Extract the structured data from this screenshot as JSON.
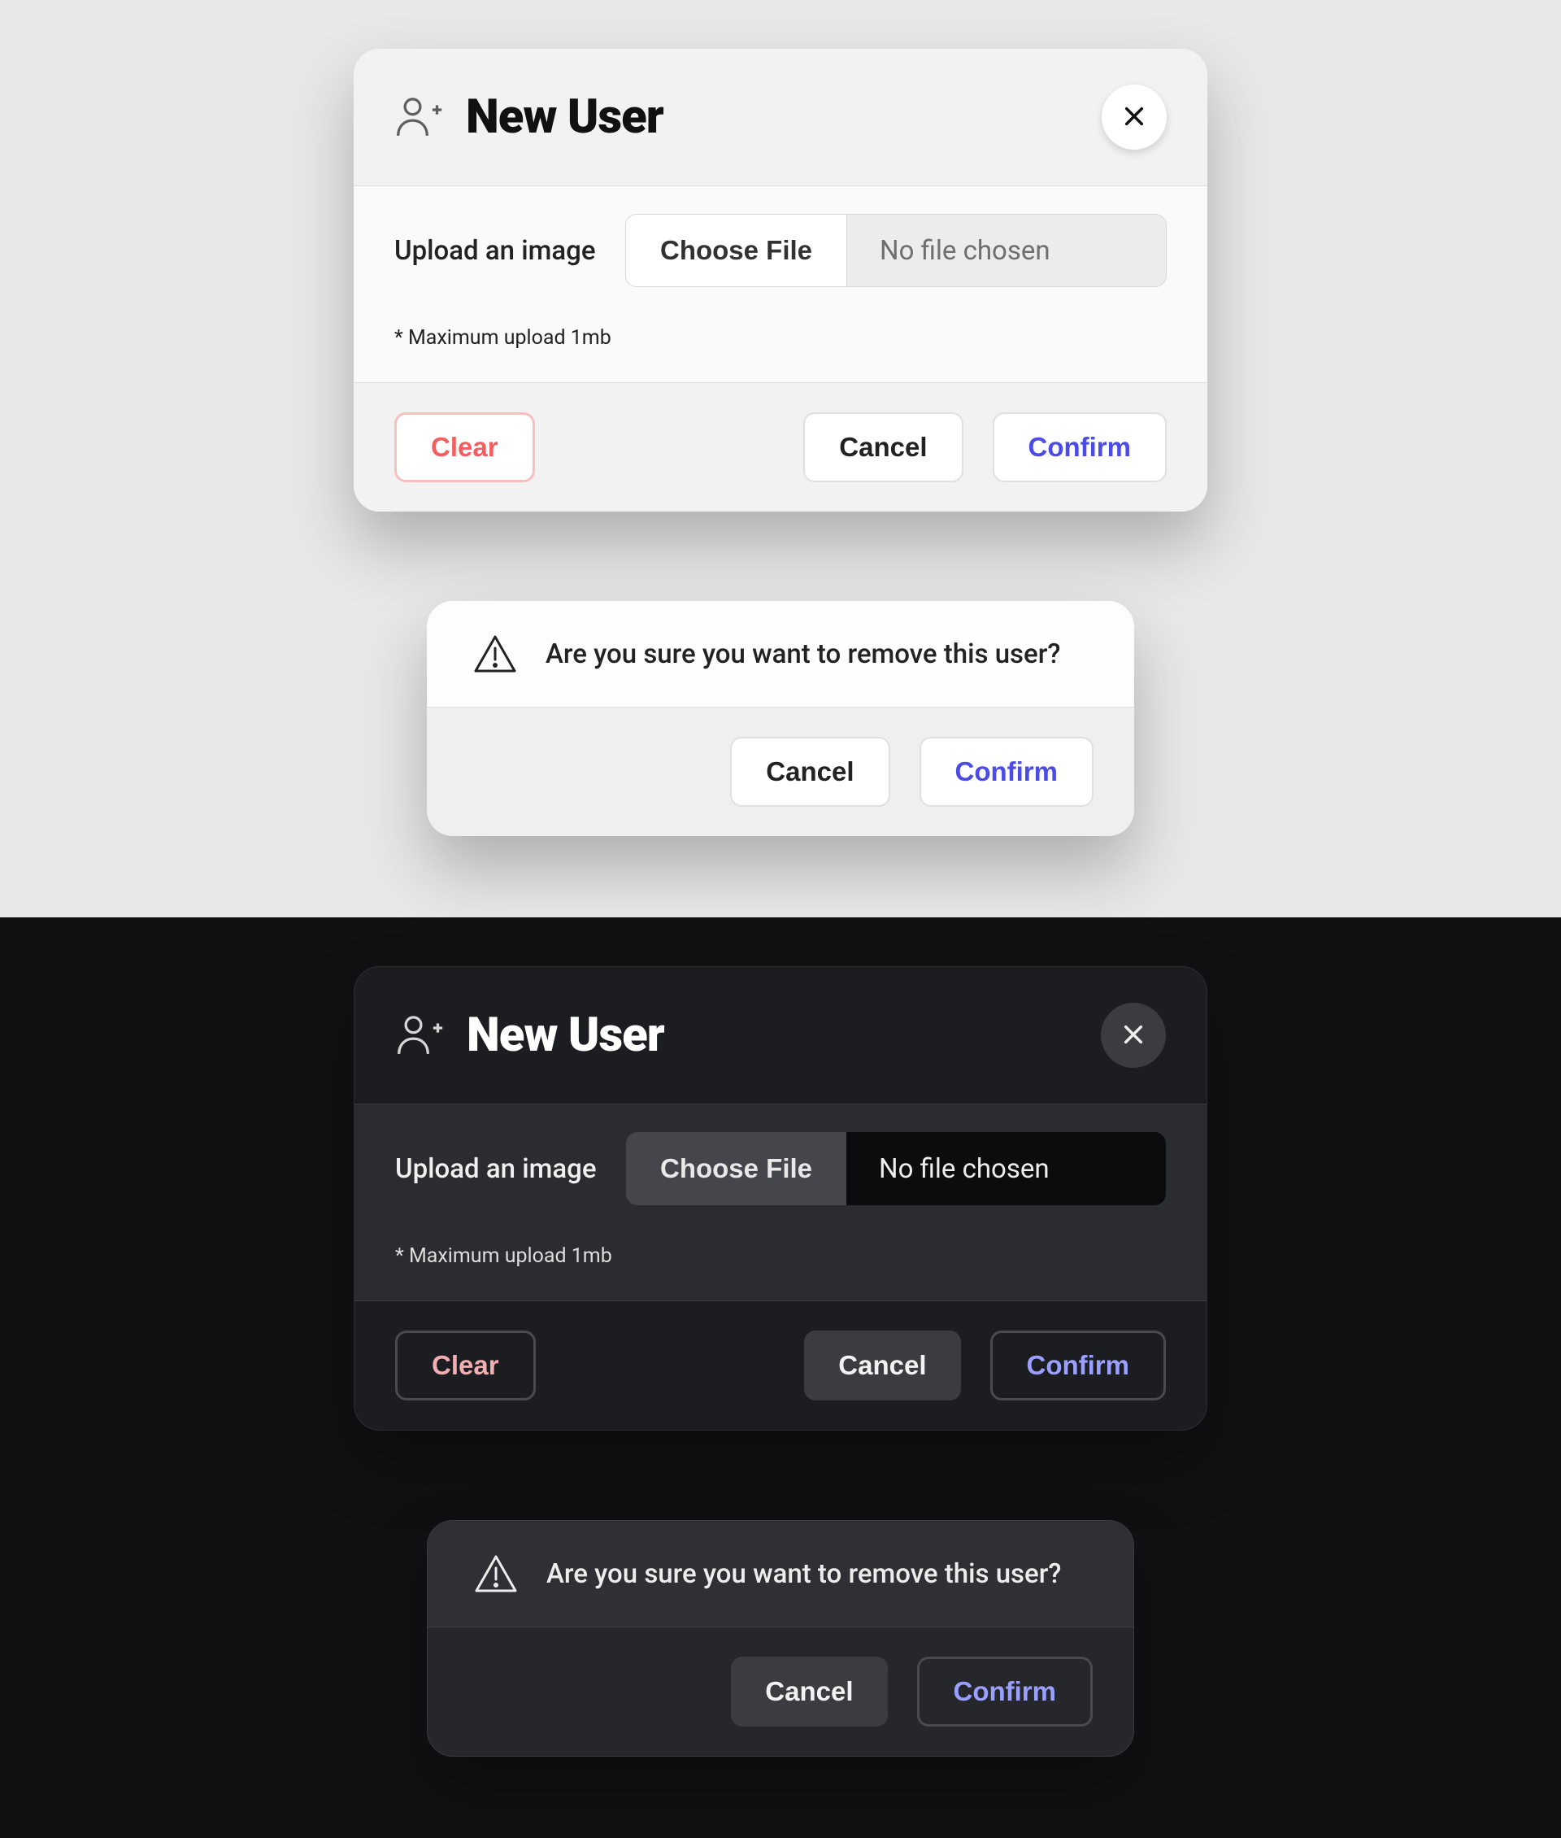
{
  "new_user": {
    "title": "New User",
    "upload_label": "Upload an image",
    "choose_file": "Choose File",
    "no_file": "No file chosen",
    "hint": "* Maximum upload 1mb",
    "clear": "Clear",
    "cancel": "Cancel",
    "confirm": "Confirm"
  },
  "remove_user": {
    "message": "Are you sure you want to remove this user?",
    "cancel": "Cancel",
    "confirm": "Confirm"
  },
  "colors": {
    "accent_blue": "#4b4be8",
    "accent_red": "#f15f5f",
    "dark_bg": "#101113",
    "light_bg": "#e8e8e8"
  }
}
